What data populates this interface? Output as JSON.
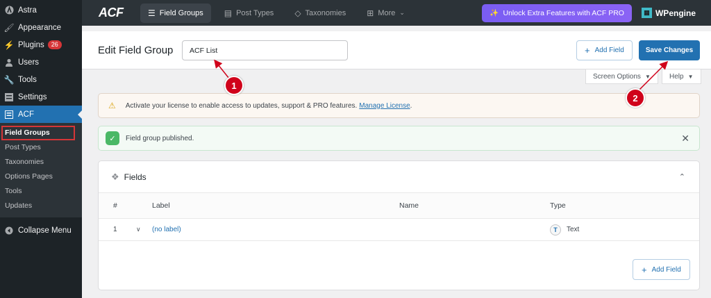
{
  "sidebar": {
    "items": [
      {
        "label": "Astra",
        "icon": "astra-icon"
      },
      {
        "label": "Appearance",
        "icon": "brush-icon"
      },
      {
        "label": "Plugins",
        "icon": "plug-icon",
        "badge": "26"
      },
      {
        "label": "Users",
        "icon": "user-icon"
      },
      {
        "label": "Tools",
        "icon": "wrench-icon"
      },
      {
        "label": "Settings",
        "icon": "sliders-icon"
      },
      {
        "label": "ACF",
        "icon": "acf-icon"
      }
    ],
    "submenu": [
      "Field Groups",
      "Post Types",
      "Taxonomies",
      "Options Pages",
      "Tools",
      "Updates"
    ],
    "collapse": "Collapse Menu"
  },
  "topbar": {
    "logo": "ACF",
    "tabs": [
      "Field Groups",
      "Post Types",
      "Taxonomies",
      "More"
    ],
    "unlock": "Unlock Extra Features with ACF PRO",
    "partner": "WPengine"
  },
  "header": {
    "title": "Edit Field Group",
    "group_name": "ACF List",
    "add_field": "Add Field",
    "save": "Save Changes"
  },
  "screen": {
    "options": "Screen Options",
    "help": "Help"
  },
  "notices": {
    "license_text": "Activate your license to enable access to updates, support & PRO features.",
    "license_link": "Manage License",
    "license_end": ".",
    "published": "Field group published."
  },
  "fields": {
    "title": "Fields",
    "columns": {
      "num": "#",
      "label": "Label",
      "name": "Name",
      "type": "Type"
    },
    "rows": [
      {
        "num": "1",
        "label": "(no label)",
        "name": "",
        "type": "Text",
        "type_icon": "T"
      }
    ],
    "add_field": "Add Field"
  },
  "annotations": {
    "one": "1",
    "two": "2"
  },
  "colors": {
    "accent": "#2271b1",
    "sidebar": "#1d2327",
    "marker": "#d0021b",
    "pro": "#7a5df3"
  }
}
